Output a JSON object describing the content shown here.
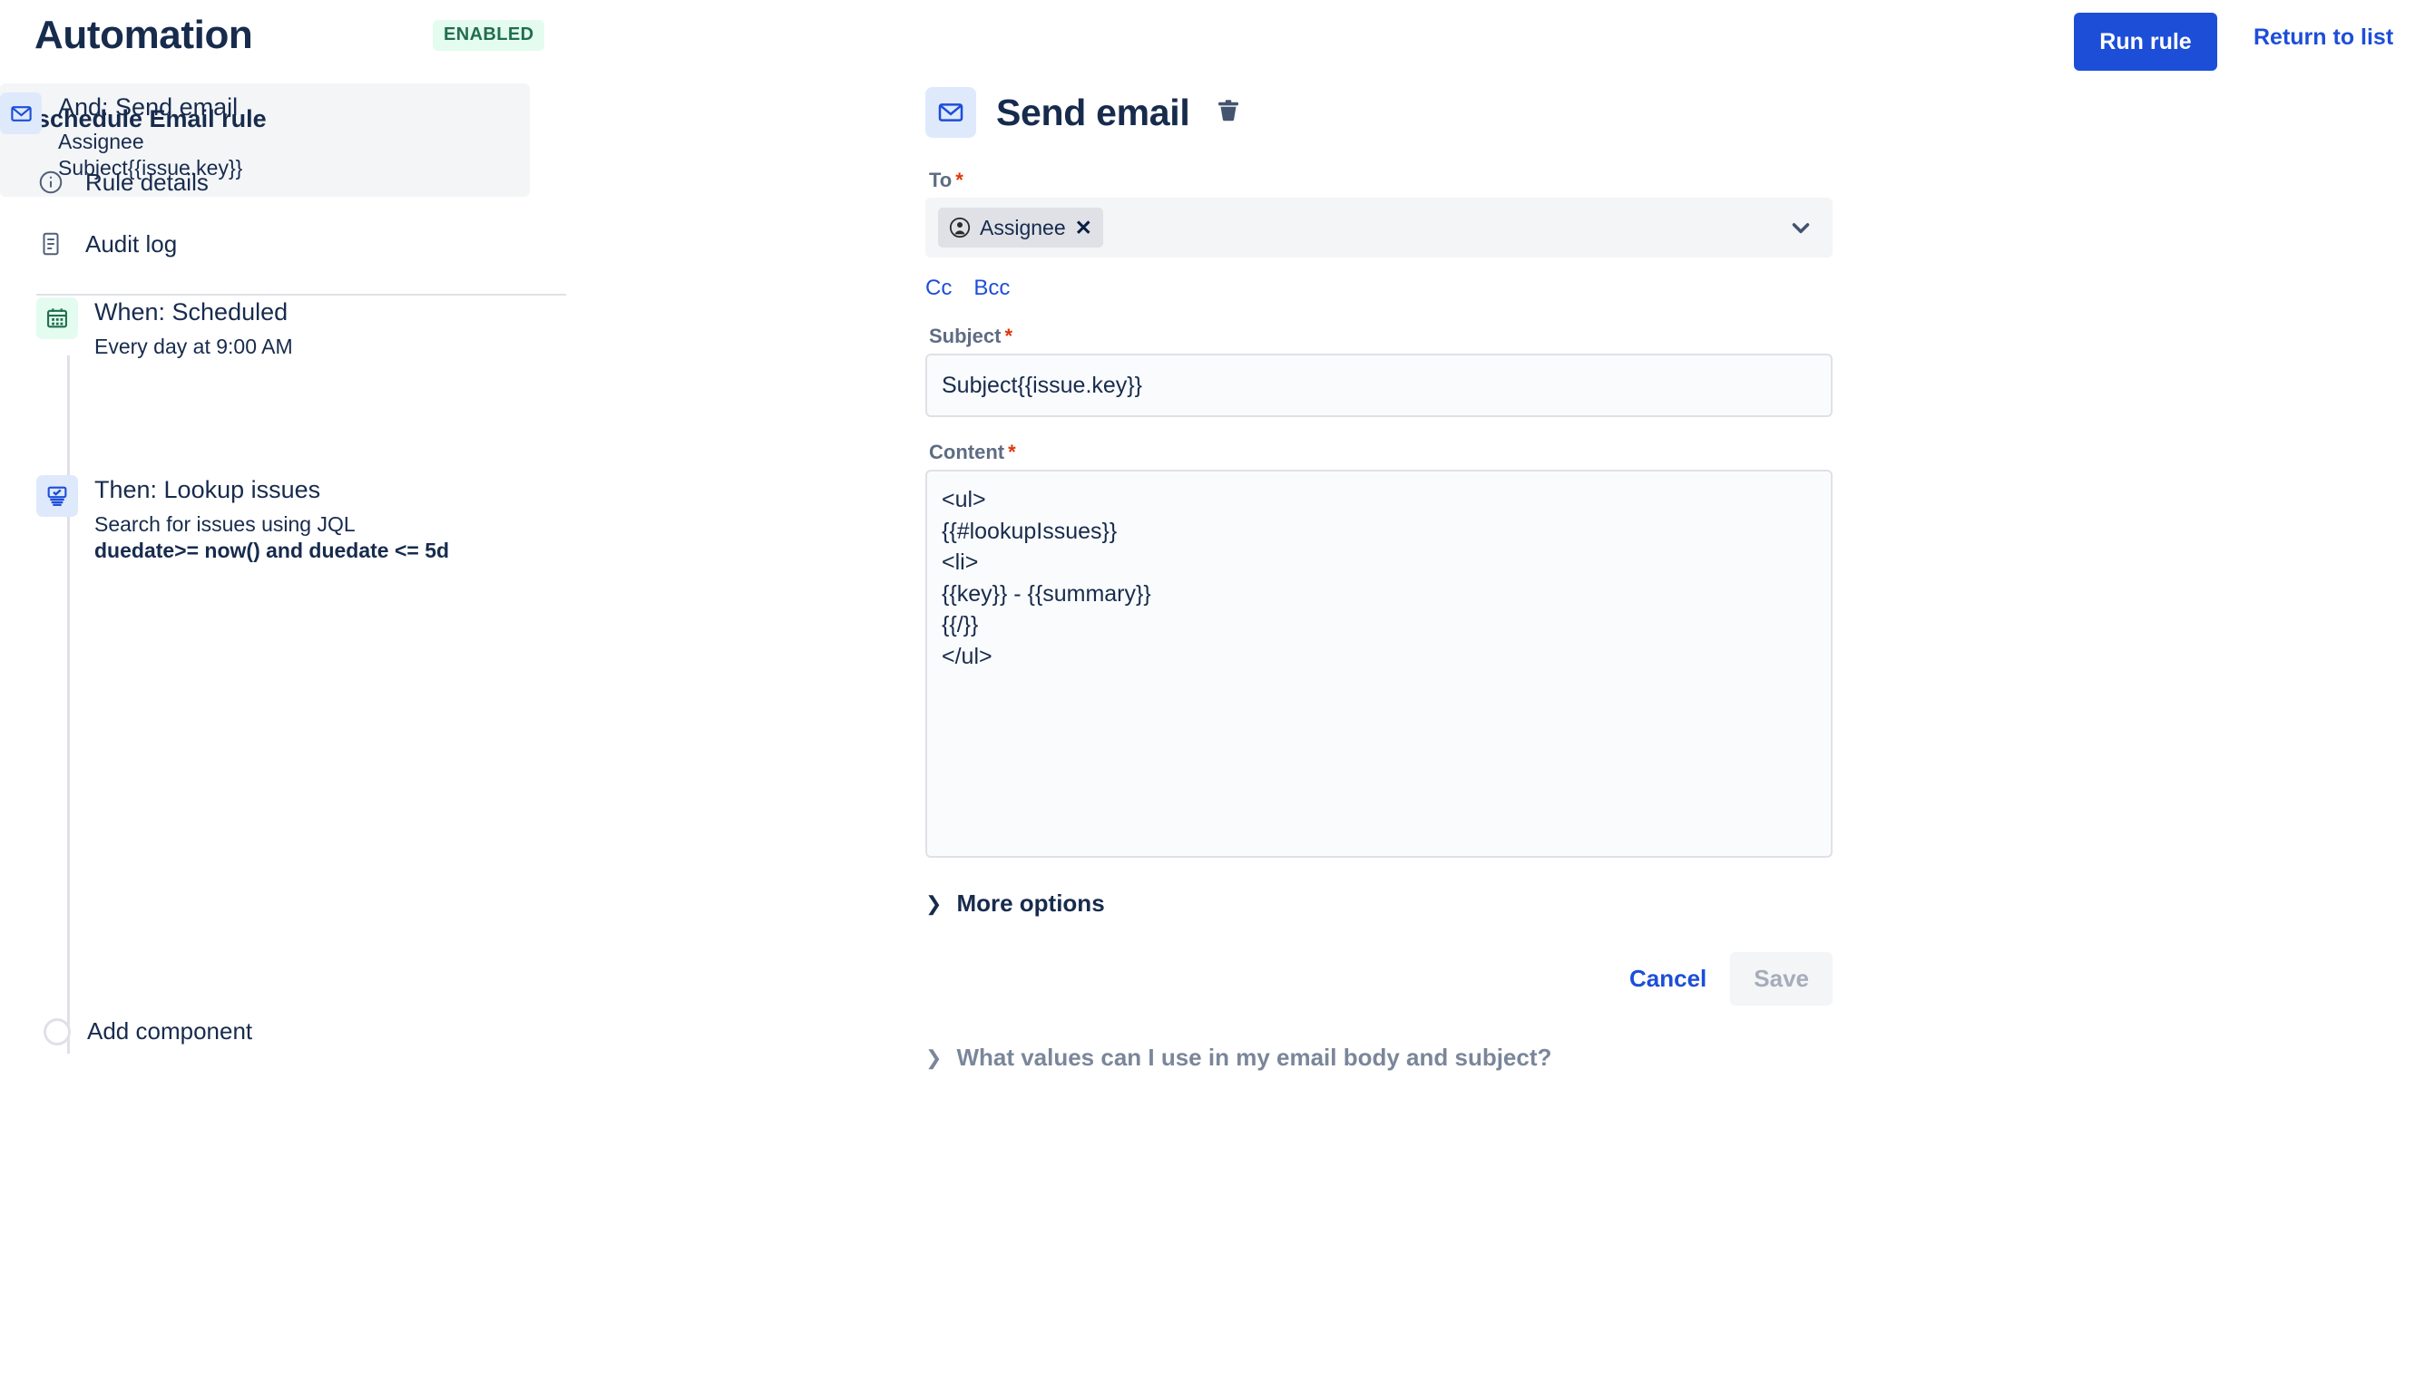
{
  "header": {
    "app_title": "Automation",
    "status_badge": "ENABLED",
    "run_rule_label": "Run rule",
    "return_to_list_label": "Return to list",
    "primary_color": "#1D4ED8",
    "badge_bg": "#E3FCEF",
    "badge_fg": "#216E4E"
  },
  "sidebar": {
    "rule_name": "schedule Email rule",
    "nav": [
      {
        "label": "Rule details",
        "icon": "info-circle-icon"
      },
      {
        "label": "Audit log",
        "icon": "document-list-icon"
      }
    ],
    "steps": [
      {
        "title": "When: Scheduled",
        "subtitle": "Every day at 9:00 AM",
        "icon": "calendar-icon",
        "badge_color": "#E3FCEF",
        "selected": false
      },
      {
        "title": "Then: Lookup issues",
        "subtitle": "Search for issues using JQL",
        "subtitle_bold": "duedate>= now() and duedate <= 5d",
        "icon": "lookup-issues-icon",
        "badge_color": "#DEE9FC",
        "selected": false
      },
      {
        "title": "And: Send email",
        "subtitle_line1": "Assignee",
        "subtitle_line2": "Subject{{issue.key}}",
        "icon": "email-icon",
        "badge_color": "#DEE9FC",
        "selected": true
      }
    ],
    "add_component_label": "Add component"
  },
  "main": {
    "panel_icon": "email-icon",
    "panel_title": "Send email",
    "delete_icon": "trash-icon",
    "to": {
      "label": "To",
      "required_mark": "*",
      "chips": [
        {
          "label": "Assignee",
          "icon": "avatar-icon",
          "remove_icon": "close-icon"
        }
      ],
      "chevron_icon": "chevron-down-icon"
    },
    "cc_label": "Cc",
    "bcc_label": "Bcc",
    "subject": {
      "label": "Subject",
      "required_mark": "*",
      "value": "Subject{{issue.key}}",
      "placeholder": ""
    },
    "content": {
      "label": "Content",
      "required_mark": "*",
      "value": "<ul>\n{{#lookupIssues}}\n<li>\n{{key}} - {{summary}}\n{{/}}\n</ul>",
      "placeholder": ""
    },
    "more_options_label": "More options",
    "cancel_label": "Cancel",
    "save_label": "Save",
    "help_expander_label": "What values can I use in my email body and subject?"
  }
}
